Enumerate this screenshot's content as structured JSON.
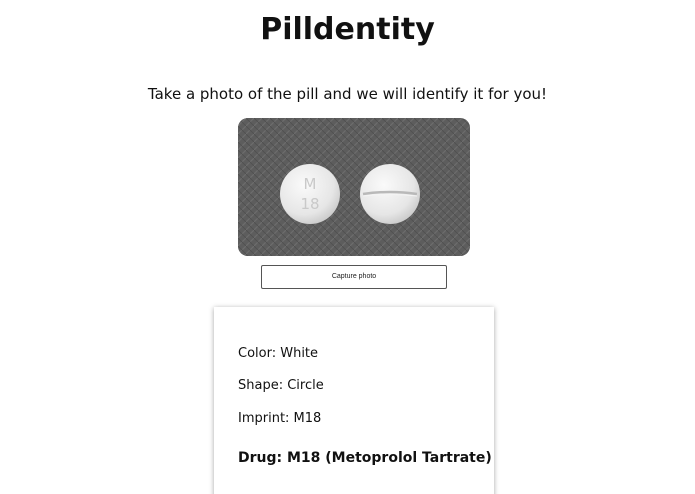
{
  "app": {
    "title": "Pilldentity",
    "subtitle": "Take a photo of the pill and we will identify it for you!"
  },
  "photo": {
    "pill_imprint_top": "M",
    "pill_imprint_bottom": "18",
    "background_color": "#5f5f5f",
    "pill_color": "#ededed"
  },
  "actions": {
    "capture_label": "Capture photo"
  },
  "result": {
    "color": "Color: White",
    "shape": "Shape: Circle",
    "imprint": "Imprint: M18",
    "drug": "Drug: M18 (Metoprolol Tartrate)"
  }
}
